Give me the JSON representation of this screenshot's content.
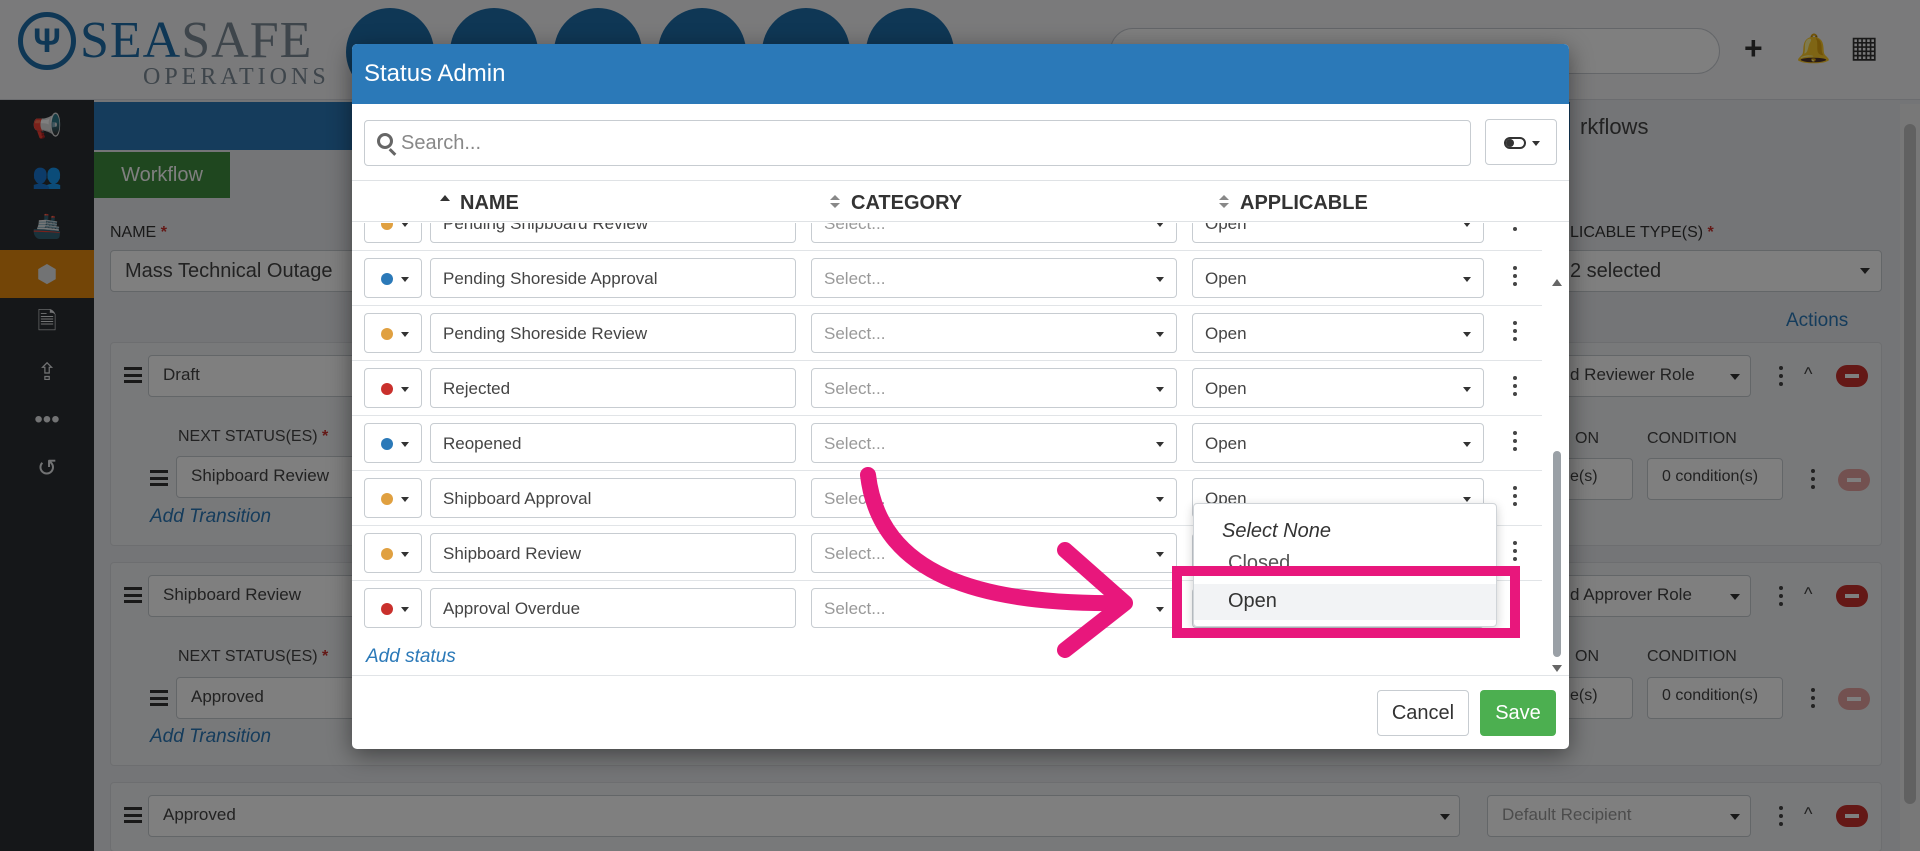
{
  "brand": {
    "name_a": "SEA",
    "name_b": "SAFE",
    "sub": "OPERATIONS",
    "accent": "#1f6eab"
  },
  "background": {
    "tab_workflow": "Workflow",
    "band_right_text": "rkflows",
    "name_label": "NAME",
    "name_value": "Mass Technical Outage",
    "applicable_label": "LICABLE TYPE(S)",
    "applicable_value": "2 selected",
    "actions": "Actions",
    "cards": [
      {
        "title": "Draft",
        "next_label": "NEXT STATUS(ES)",
        "next_value": "Shipboard Review",
        "add_transition": "Add Transition",
        "role": "d Reviewer Role",
        "on_label": "ON",
        "cond_label": "CONDITION",
        "cond_value": "0 condition(s)",
        "es_value": "e(s)"
      },
      {
        "title": "Shipboard Review",
        "next_label": "NEXT STATUS(ES)",
        "next_value": "Approved",
        "add_transition": "Add Transition",
        "role": "d Approver Role",
        "on_label": "ON",
        "cond_label": "CONDITION",
        "cond_value": "0 condition(s)",
        "es_value": "e(s)"
      },
      {
        "title": "Approved",
        "role": "Default Recipient"
      }
    ]
  },
  "modal": {
    "title": "Status Admin",
    "search_placeholder": "Search...",
    "columns": {
      "name": "NAME",
      "category": "CATEGORY",
      "applicable": "APPLICABLE"
    },
    "partial_row": {
      "name": "Pending Shipboard Review",
      "category": "Select...",
      "applicable": "Open",
      "color": "#e0a040"
    },
    "rows": [
      {
        "name": "Pending Shoreside Approval",
        "category": "Select...",
        "applicable": "Open",
        "color": "#2b79b8"
      },
      {
        "name": "Pending Shoreside Review",
        "category": "Select...",
        "applicable": "Open",
        "color": "#e0a040"
      },
      {
        "name": "Rejected",
        "category": "Select...",
        "applicable": "Open",
        "color": "#c9302c"
      },
      {
        "name": "Reopened",
        "category": "Select...",
        "applicable": "Open",
        "color": "#2b79b8"
      },
      {
        "name": "Shipboard Approval",
        "category": "Select...",
        "applicable": "Open",
        "color": "#e0a040"
      },
      {
        "name": "Shipboard Review",
        "category": "Select...",
        "applicable": "",
        "color": "#e0a040"
      },
      {
        "name": "Approval Overdue",
        "category": "Select...",
        "applicable": "",
        "color": "#c9302c"
      }
    ],
    "add_status": "Add status",
    "cancel": "Cancel",
    "save": "Save"
  },
  "dropdown": {
    "select_none": "Select None",
    "options": [
      "Closed",
      "Open"
    ],
    "highlighted": "Open"
  },
  "annotation_color": "#e8177c"
}
